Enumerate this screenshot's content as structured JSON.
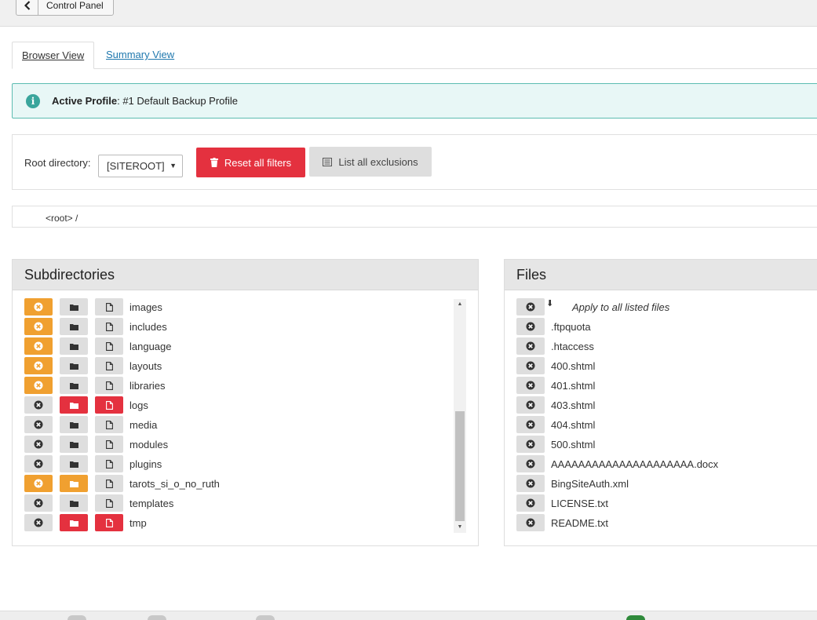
{
  "toolbar": {
    "back_label": "Control Panel"
  },
  "tabs": [
    {
      "label": "Browser View",
      "active": true
    },
    {
      "label": "Summary View",
      "active": false
    }
  ],
  "alert": {
    "bold": "Active Profile",
    "text": ": #1 Default Backup Profile"
  },
  "filters": {
    "root_label": "Root directory:",
    "root_value": "[SITEROOT]",
    "reset_label": "Reset all filters",
    "list_label": "List all exclusions"
  },
  "path": "<root> /",
  "subdirectories": {
    "title": "Subdirectories",
    "items": [
      {
        "name": "images",
        "states": [
          "orange",
          "gray",
          "gray"
        ]
      },
      {
        "name": "includes",
        "states": [
          "orange",
          "gray",
          "gray"
        ]
      },
      {
        "name": "language",
        "states": [
          "orange",
          "gray",
          "gray"
        ]
      },
      {
        "name": "layouts",
        "states": [
          "orange",
          "gray",
          "gray"
        ]
      },
      {
        "name": "libraries",
        "states": [
          "orange",
          "gray",
          "gray"
        ]
      },
      {
        "name": "logs",
        "states": [
          "gray",
          "red",
          "red"
        ]
      },
      {
        "name": "media",
        "states": [
          "gray",
          "gray",
          "gray"
        ]
      },
      {
        "name": "modules",
        "states": [
          "gray",
          "gray",
          "gray"
        ]
      },
      {
        "name": "plugins",
        "states": [
          "gray",
          "gray",
          "gray"
        ]
      },
      {
        "name": "tarots_si_o_no_ruth",
        "states": [
          "orange",
          "orange",
          "gray"
        ]
      },
      {
        "name": "templates",
        "states": [
          "gray",
          "gray",
          "gray"
        ]
      },
      {
        "name": "tmp",
        "states": [
          "gray",
          "red",
          "red"
        ]
      }
    ]
  },
  "files": {
    "title": "Files",
    "apply_label": "Apply to all listed files",
    "items": [
      ".ftpquota",
      ".htaccess",
      "400.shtml",
      "401.shtml",
      "403.shtml",
      "404.shtml",
      "500.shtml",
      "AAAAAAAAAAAAAAAAAAAAA.docx",
      "BingSiteAuth.xml",
      "LICENSE.txt",
      "README.txt"
    ]
  },
  "colors": {
    "orange": "#f0a030",
    "red": "#e4313f",
    "gray": "#dedede",
    "teal": "#3aa59c"
  }
}
